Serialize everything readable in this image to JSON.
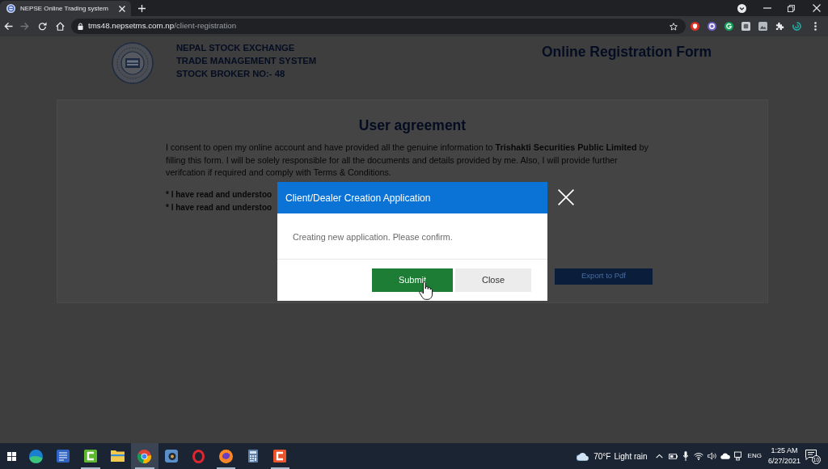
{
  "browser": {
    "tab": {
      "title": "NEPSE Online Trading system"
    },
    "address": {
      "host": "tms48.nepsetms.com.np",
      "path": "/client-registration"
    }
  },
  "header": {
    "lines": [
      "NEPAL STOCK EXCHANGE",
      "TRADE MANAGEMENT SYSTEM",
      "STOCK BROKER NO:- 48"
    ],
    "title": "Online Registration Form"
  },
  "agreement": {
    "heading": "User agreement",
    "text": "I consent to open my online account and have provided all the genuine information to **Trishakti Securities Public Limited** by filling this form. I will be solely responsible for all the documents and details provided by me. Also, I will provide further verifcation if required and comply with Terms & Conditions.",
    "declarations": [
      "* I have read and understoo",
      "* I have read and understoo"
    ],
    "export_button": "Export to Pdf"
  },
  "dialog": {
    "title": "Client/Dealer Creation Application",
    "message": "Creating new application. Please confirm.",
    "buttons": [
      {
        "label": "Submit",
        "kind": "primary"
      },
      {
        "label": "Close",
        "kind": "secondary"
      }
    ]
  },
  "taskbar": {
    "apps": [
      {
        "kind": "swirl",
        "running": false,
        "selected": false
      },
      {
        "kind": "doc-tile",
        "running": false,
        "selected": false
      },
      {
        "kind": "bracket-tile",
        "color": "#5cb82e",
        "running": true,
        "selected": false
      },
      {
        "kind": "folder",
        "running": false,
        "selected": false
      },
      {
        "kind": "ring",
        "running": true,
        "selected": true
      },
      {
        "kind": "lens",
        "running": false,
        "selected": false
      },
      {
        "kind": "o-ring",
        "running": false,
        "selected": false
      },
      {
        "kind": "fox",
        "running": true,
        "selected": false
      },
      {
        "kind": "calculator",
        "running": false,
        "selected": false
      },
      {
        "kind": "bracket-tile",
        "color": "#e8542b",
        "running": true,
        "selected": false
      }
    ]
  },
  "tray": {
    "temperature": "70°F",
    "weather": "Light rain",
    "language": "ENG",
    "time": "1:25 AM",
    "date": "6/27/2021",
    "notifications": "10"
  }
}
